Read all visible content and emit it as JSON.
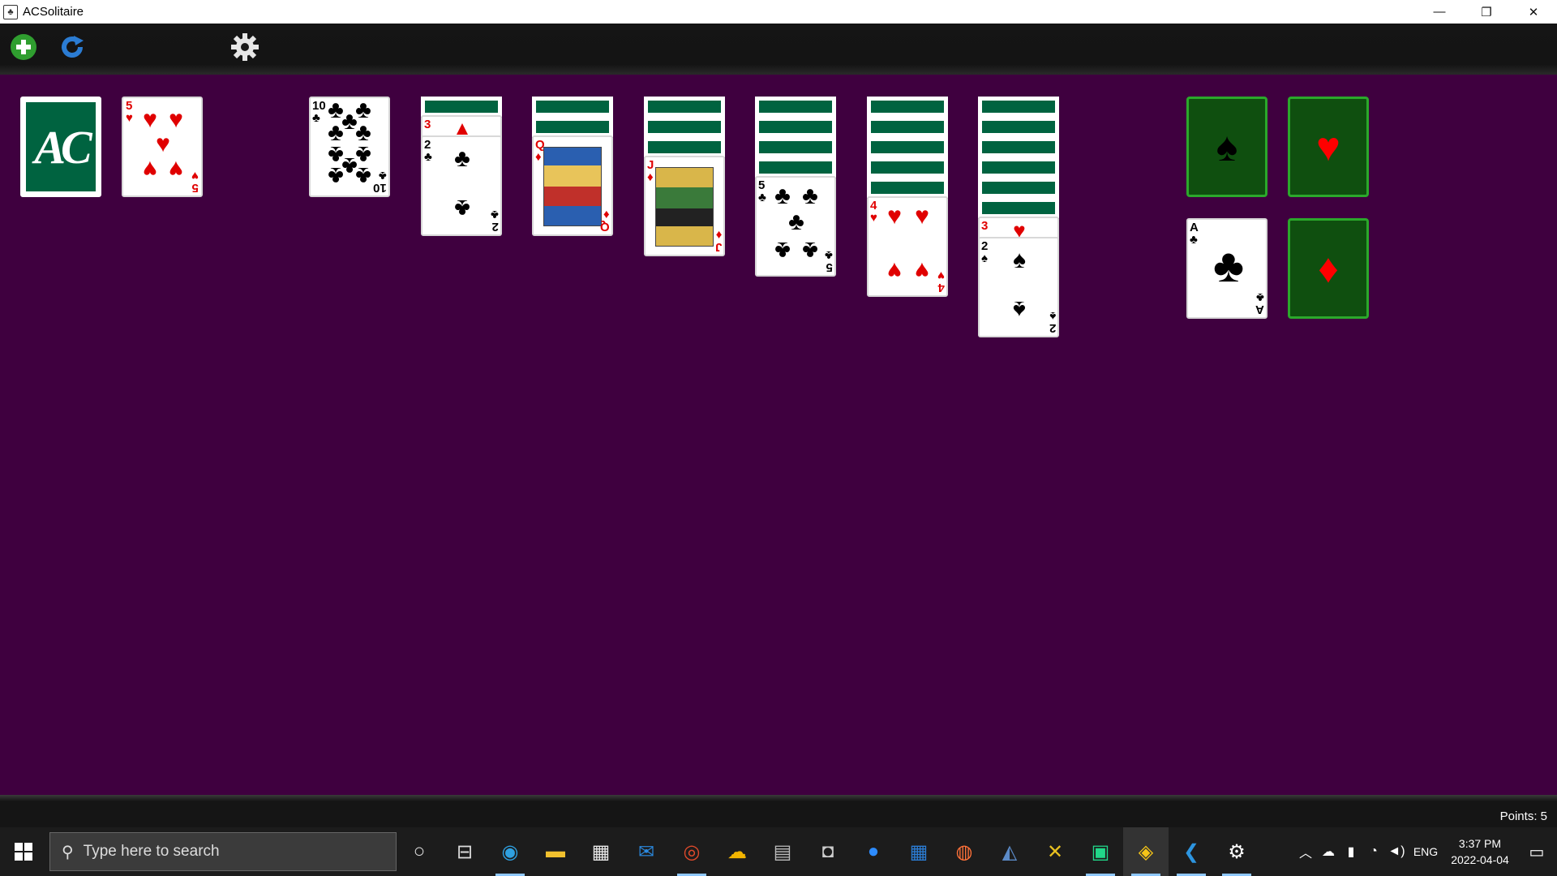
{
  "window": {
    "title": "ACSolitaire",
    "minimize": "—",
    "restore": "❐",
    "close": "✕"
  },
  "toolbar": {
    "new_game": "+",
    "undo": "↻",
    "settings": "⚙"
  },
  "stock": {
    "logo": "AC"
  },
  "waste": {
    "rank": "5",
    "suit": "♥"
  },
  "tableau": [
    {
      "hidden": 0,
      "visible": [
        {
          "rank": "10",
          "suit": "♣"
        }
      ]
    },
    {
      "hidden": 1,
      "visible": [
        {
          "rank": "3",
          "suit": "♦"
        },
        {
          "rank": "2",
          "suit": "♣"
        }
      ]
    },
    {
      "hidden": 2,
      "visible": [
        {
          "rank": "Q",
          "suit": "♦"
        }
      ]
    },
    {
      "hidden": 3,
      "visible": [
        {
          "rank": "J",
          "suit": "♦"
        }
      ]
    },
    {
      "hidden": 4,
      "visible": [
        {
          "rank": "5",
          "suit": "♣"
        }
      ]
    },
    {
      "hidden": 5,
      "visible": [
        {
          "rank": "4",
          "suit": "♥"
        }
      ]
    },
    {
      "hidden": 6,
      "visible": [
        {
          "rank": "3",
          "suit": "♥"
        },
        {
          "rank": "2",
          "suit": "♠"
        }
      ]
    }
  ],
  "foundations": [
    {
      "placeholder": "♠",
      "color": "#000000"
    },
    {
      "placeholder": "♥",
      "color": "#ff0000"
    },
    {
      "top_card": {
        "rank": "A",
        "suit": "♣"
      }
    },
    {
      "placeholder": "♦",
      "color": "#ff0000"
    }
  ],
  "status": {
    "points": "Points: 5"
  },
  "taskbar": {
    "search_placeholder": "Type here to search",
    "icons": [
      "cortana-icon",
      "task-view-icon",
      "edge-icon",
      "file-explorer-icon",
      "store-icon",
      "mail-icon",
      "chrome-icon",
      "weather-icon",
      "calculator-icon",
      "camera-icon",
      "zoom-icon",
      "calendar-icon",
      "firefox-icon",
      "mysql-icon",
      "tool-icon",
      "pycharm-icon",
      "python-icon",
      "vscode-icon",
      "settings-icon"
    ],
    "tray_lang": "ENG",
    "time": "3:37 PM",
    "date": "2022-04-04"
  }
}
